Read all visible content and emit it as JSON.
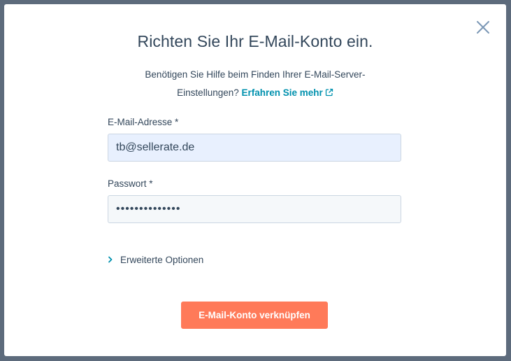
{
  "dialog": {
    "title": "Richten Sie Ihr E-Mail-Konto ein.",
    "help_text_line1": "Benötigen Sie Hilfe beim Finden Ihrer E-Mail-Server-",
    "help_text_line2": "Einstellungen?",
    "help_link": "Erfahren Sie mehr",
    "close_icon": "close-icon"
  },
  "form": {
    "email_label": "E-Mail-Adresse *",
    "email_value": "tb@sellerate.de",
    "password_label": "Passwort *",
    "password_value": "••••••••••••••",
    "advanced_label": "Erweiterte Optionen",
    "submit_label": "E-Mail-Konto verknüpfen"
  },
  "colors": {
    "accent": "#ff7a59",
    "link": "#0091ae",
    "text": "#33475b",
    "backdrop": "#5d6b7c"
  }
}
